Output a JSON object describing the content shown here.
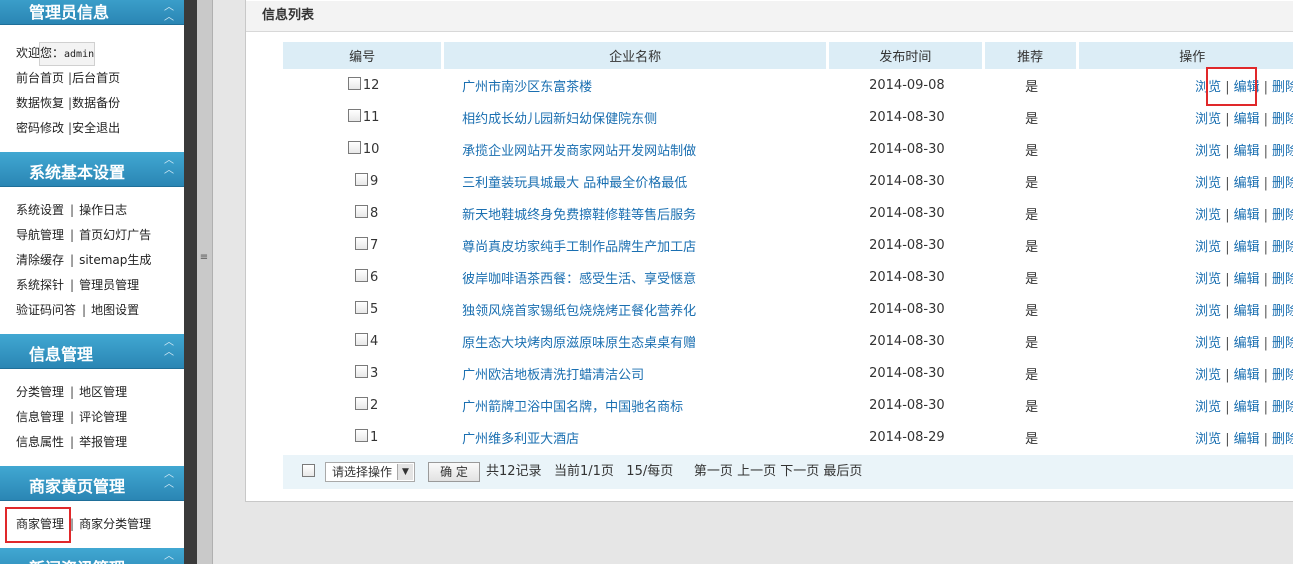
{
  "sidebar": {
    "sections": [
      {
        "title": "管理员信息",
        "welcome_label": "欢迎您：",
        "welcome_user": "admin",
        "rows": [
          [
            "前台首页",
            "后台首页"
          ],
          [
            "数据恢复",
            "数据备份"
          ],
          [
            "密码修改",
            "安全退出"
          ]
        ]
      },
      {
        "title": "系统基本设置",
        "rows": [
          [
            "系统设置",
            "操作日志"
          ],
          [
            "导航管理",
            "首页幻灯广告"
          ],
          [
            "清除缓存",
            "sitemap生成"
          ],
          [
            "系统探针",
            "管理员管理"
          ],
          [
            "验证码问答",
            "地图设置"
          ]
        ]
      },
      {
        "title": "信息管理",
        "rows": [
          [
            "分类管理",
            "地区管理"
          ],
          [
            "信息管理",
            "评论管理"
          ],
          [
            "信息属性",
            "举报管理"
          ]
        ]
      },
      {
        "title": "商家黄页管理",
        "rows": [
          [
            "商家管理",
            "商家分类管理"
          ]
        ]
      },
      {
        "title": "新闻资讯管理",
        "rows": []
      }
    ],
    "toggle_icon": "chevron-up-double",
    "separator": "|"
  },
  "splitter": {
    "grip": "≡"
  },
  "panel": {
    "title": "信息列表",
    "columns": [
      "编号",
      "企业名称",
      "发布时间",
      "推荐",
      "操作"
    ],
    "rows": [
      {
        "id": "12",
        "name": "广州市南沙区东富茶楼",
        "date": "2014-09-08",
        "recommended": "是"
      },
      {
        "id": "11",
        "name": "相约成长幼儿园新妇幼保健院东侧",
        "date": "2014-08-30",
        "recommended": "是"
      },
      {
        "id": "10",
        "name": "承揽企业网站开发商家网站开发网站制做",
        "date": "2014-08-30",
        "recommended": "是"
      },
      {
        "id": "9",
        "name": "三利童装玩具城最大 品种最全价格最低",
        "date": "2014-08-30",
        "recommended": "是"
      },
      {
        "id": "8",
        "name": "新天地鞋城终身免费擦鞋修鞋等售后服务",
        "date": "2014-08-30",
        "recommended": "是"
      },
      {
        "id": "7",
        "name": "尊尚真皮坊家纯手工制作品牌生产加工店",
        "date": "2014-08-30",
        "recommended": "是"
      },
      {
        "id": "6",
        "name": "彼岸咖啡语茶西餐：感受生活、享受惬意",
        "date": "2014-08-30",
        "recommended": "是"
      },
      {
        "id": "5",
        "name": "独领风烧首家锡纸包烧烧烤正餐化营养化",
        "date": "2014-08-30",
        "recommended": "是"
      },
      {
        "id": "4",
        "name": "原生态大块烤肉原滋原味原生态桌桌有赠",
        "date": "2014-08-30",
        "recommended": "是"
      },
      {
        "id": "3",
        "name": "广州欧洁地板清洗打蜡清洁公司",
        "date": "2014-08-30",
        "recommended": "是"
      },
      {
        "id": "2",
        "name": "广州箭牌卫浴中国名牌，中国驰名商标",
        "date": "2014-08-30",
        "recommended": "是"
      },
      {
        "id": "1",
        "name": "广州维多利亚大酒店",
        "date": "2014-08-29",
        "recommended": "是"
      }
    ],
    "actions": {
      "view": "浏览",
      "edit": "编辑",
      "delete": "删除",
      "sep": "|"
    },
    "footer": {
      "select_value": "请选择操作",
      "confirm": "确 定",
      "total": "共12记录",
      "current": "当前1/1页",
      "per_page": "15/每页",
      "first": "第一页",
      "prev": "上一页",
      "next": "下一页",
      "last": "最后页"
    }
  },
  "colors": {
    "sidebar_header": "#2a86b4",
    "link": "#1a6fb1",
    "table_header": "#dcedf6",
    "highlight": "#e0282a"
  }
}
